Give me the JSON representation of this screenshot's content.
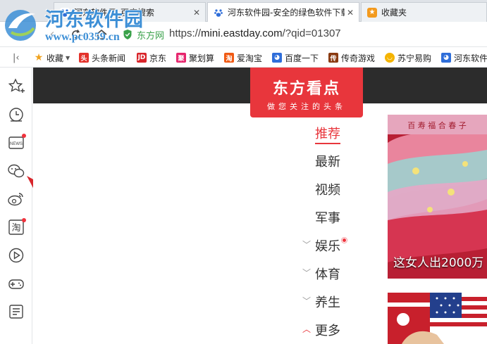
{
  "tabs": [
    {
      "label": "河东软件园_百度搜索",
      "icon": "baidu-paw-icon",
      "active": false
    },
    {
      "label": "河东软件园-安全的绿色软件下载",
      "icon": "baidu-paw-icon",
      "active": true
    },
    {
      "label": "收藏夹",
      "icon": "star-favorites-icon",
      "active": false
    }
  ],
  "address": {
    "site_name": "东方网",
    "url_scheme": "https://",
    "url_host": "mini.eastday.com",
    "url_rest": "/?qid=01307"
  },
  "watermark": {
    "title": "河东软件园",
    "url": "www.pc0359.cn"
  },
  "bookmarks": [
    {
      "label": "收藏",
      "icon": "star-icon",
      "has_caret": true
    },
    {
      "label": "头条新闻",
      "icon": "toutiao-icon"
    },
    {
      "label": "京东",
      "icon": "jd-icon"
    },
    {
      "label": "聚划算",
      "icon": "juhuasuan-icon"
    },
    {
      "label": "爱淘宝",
      "icon": "taobao-icon"
    },
    {
      "label": "百度一下",
      "icon": "baidu-paw-icon"
    },
    {
      "label": "传奇游戏",
      "icon": "game-icon"
    },
    {
      "label": "苏宁易购",
      "icon": "suning-icon"
    },
    {
      "label": "河东软件",
      "icon": "baidu-paw-icon"
    }
  ],
  "sidebar_icons": [
    "star-plus-icon",
    "clock-icon",
    "news-icon",
    "wechat-icon",
    "weibo-icon",
    "taobao-icon",
    "play-icon",
    "gamepad-icon",
    "notes-icon"
  ],
  "page": {
    "brand_title": "东方看点",
    "brand_slogan": "做您关注的头条",
    "nav": [
      {
        "label": "推荐",
        "active": true,
        "chevron": ""
      },
      {
        "label": "最新",
        "active": false,
        "chevron": ""
      },
      {
        "label": "视频",
        "active": false,
        "chevron": ""
      },
      {
        "label": "军事",
        "active": false,
        "chevron": ""
      },
      {
        "label": "娱乐",
        "active": false,
        "chevron": "down",
        "dot": true
      },
      {
        "label": "体育",
        "active": false,
        "chevron": "down"
      },
      {
        "label": "养生",
        "active": false,
        "chevron": "down"
      },
      {
        "label": "更多",
        "active": false,
        "chevron": "up"
      }
    ],
    "card1_caption": "这女人出2000万",
    "card1_banner": "百 寿 福 合 春 子"
  },
  "colors": {
    "accent_red": "#e8363c",
    "site_green": "#3aa14a",
    "watermark_blue": "#3d8fd6"
  }
}
